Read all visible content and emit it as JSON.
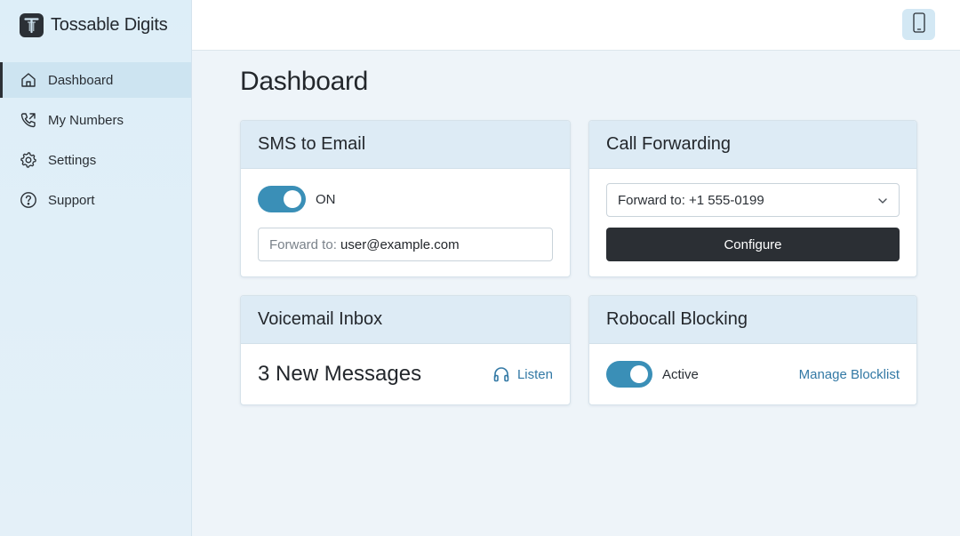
{
  "app": {
    "name": "Tossable Digits"
  },
  "sidebar": {
    "items": [
      {
        "label": "Dashboard",
        "icon": "home-icon",
        "active": true
      },
      {
        "label": "My Numbers",
        "icon": "phone-forward-icon",
        "active": false
      },
      {
        "label": "Settings",
        "icon": "gear-icon",
        "active": false
      },
      {
        "label": "Support",
        "icon": "help-circle-icon",
        "active": false
      }
    ]
  },
  "header": {
    "device_icon": "smartphone-icon"
  },
  "main": {
    "title": "Dashboard"
  },
  "cards": {
    "sms": {
      "title": "SMS to Email",
      "toggle_label": "ON",
      "toggle_on": true,
      "forward_prefix": "Forward to: ",
      "forward_value": "user@example.com"
    },
    "call": {
      "title": "Call Forwarding",
      "select_value": "Forward to: +1 555-0199",
      "configure_label": "Configure"
    },
    "voicemail": {
      "title": "Voicemail Inbox",
      "messages_text": "3 New Messages",
      "listen_label": "Listen"
    },
    "robocall": {
      "title": "Robocall Blocking",
      "toggle_label": "Active",
      "toggle_on": true,
      "manage_label": "Manage Blocklist"
    }
  },
  "colors": {
    "accent": "#3a8fb7",
    "link": "#3379a5",
    "dark_button": "#2b2f34",
    "card_header": "#ddebf5"
  }
}
